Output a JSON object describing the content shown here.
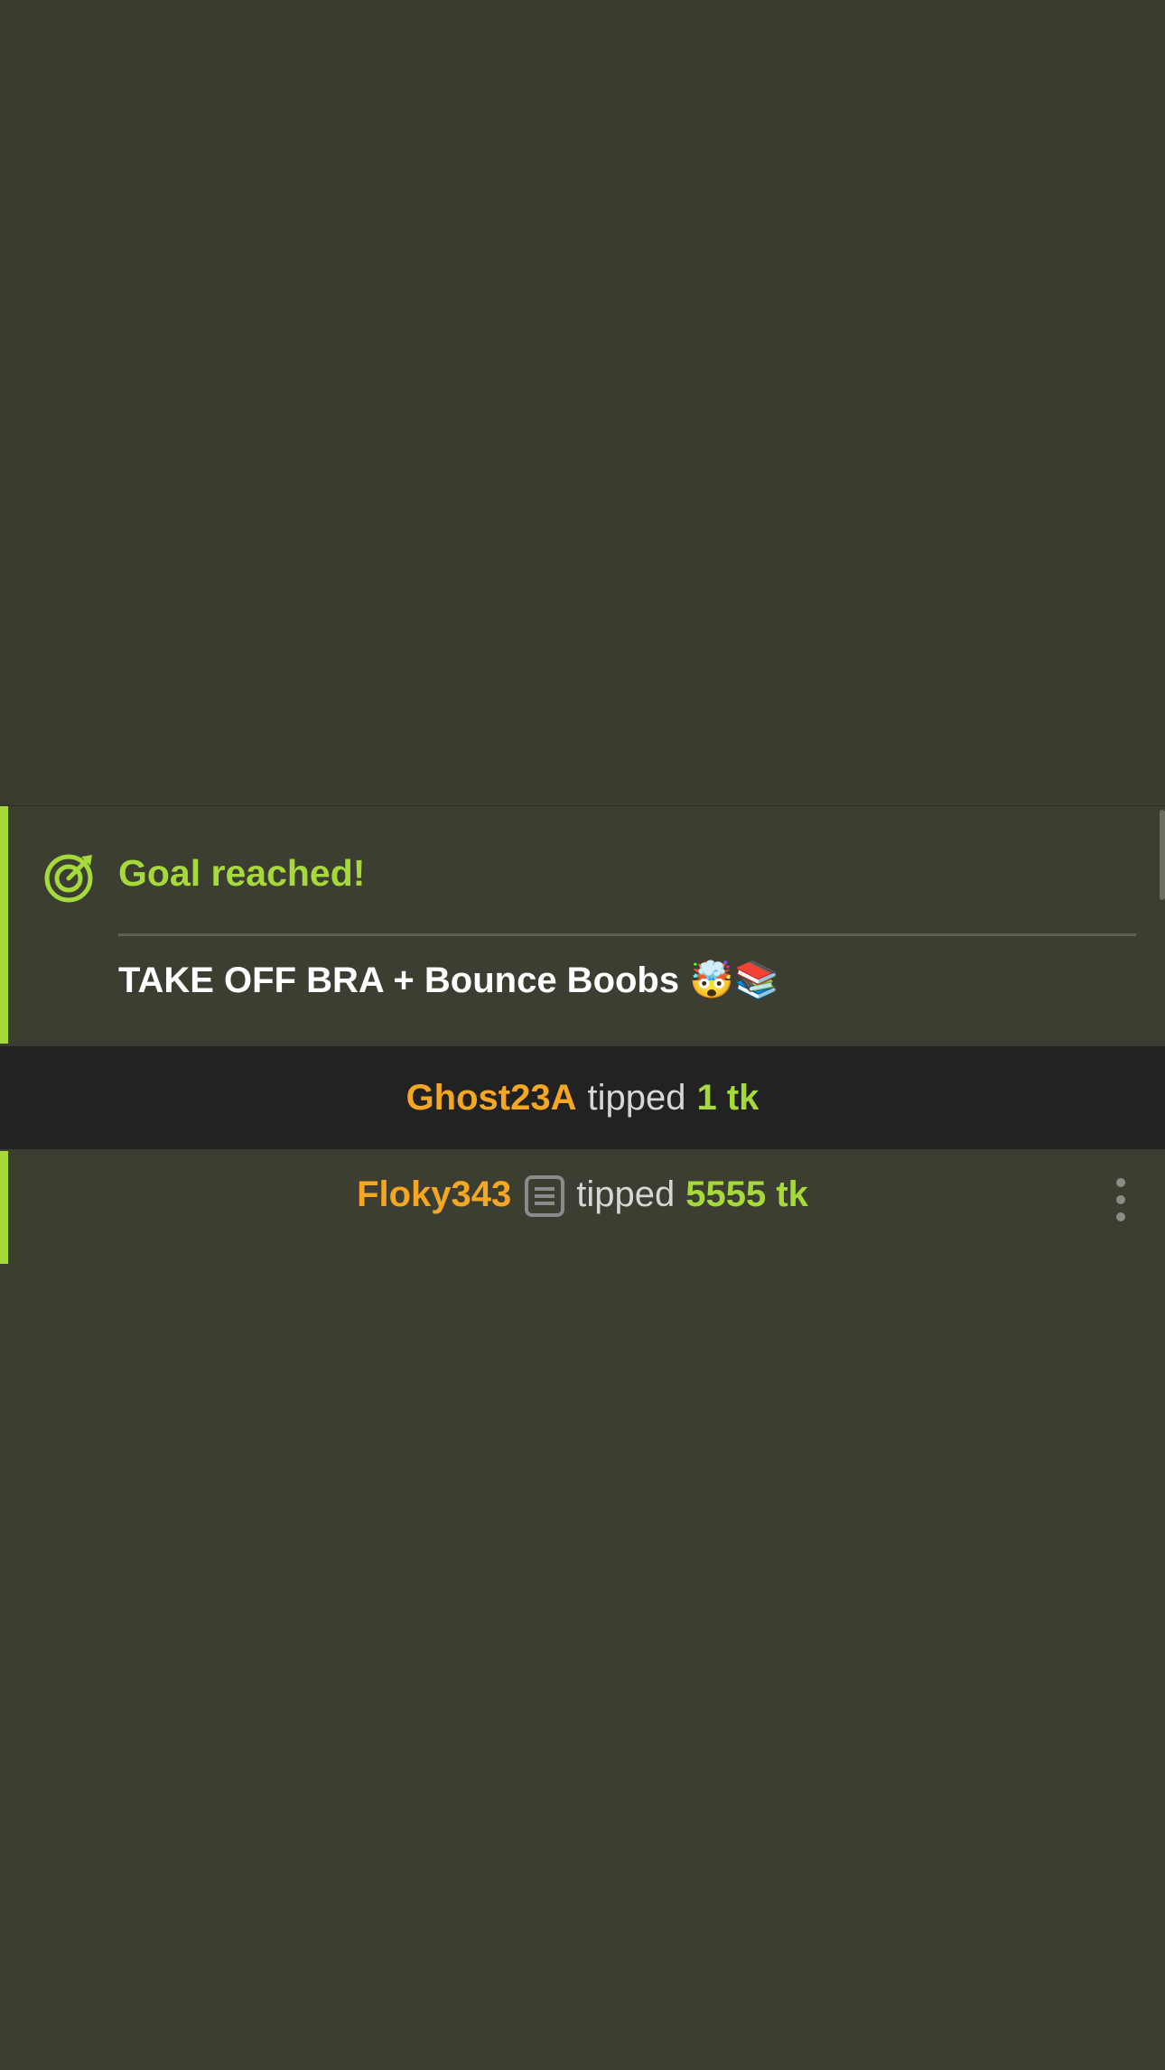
{
  "colors": {
    "accent_green": "#a6d93a",
    "username_orange": "#f5a623",
    "background": "#3a3d30",
    "dark_row": "#222222"
  },
  "goal_message": {
    "icon": "target-icon",
    "title": "Goal reached!",
    "text": "TAKE OFF BRA + Bounce Boobs",
    "emojis": "🤯📚"
  },
  "tips": [
    {
      "username": "Ghost23A",
      "verb": "tipped",
      "amount": "1 tk"
    },
    {
      "username": "Floky343",
      "note_icon": "note-icon",
      "verb": "tipped",
      "amount": "5555 tk",
      "menu_icon": "more-vertical-icon"
    }
  ]
}
